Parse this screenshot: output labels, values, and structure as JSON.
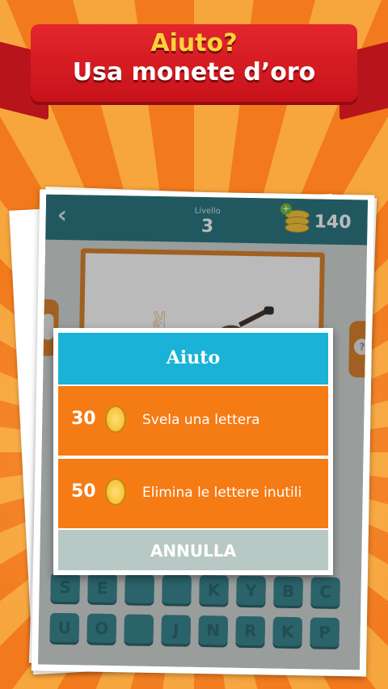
{
  "banner": {
    "line1": "Aiuto?",
    "line2": "Usa monete d’oro"
  },
  "game": {
    "level_label": "Livello",
    "level_number": "3",
    "coins": "140",
    "plus": "+",
    "back_glyph": "‹",
    "help_glyph": "?",
    "keyboard_row1": [
      "S",
      "E",
      "",
      "",
      "K",
      "Y",
      "B",
      "C"
    ],
    "keyboard_row2": [
      "U",
      "O",
      "",
      "J",
      "N",
      "R",
      "K",
      "P"
    ]
  },
  "dialog": {
    "title": "Aiuto",
    "options": [
      {
        "cost": "30",
        "label": "Svela una lettera"
      },
      {
        "cost": "50",
        "label": "Elimina le lettere inutili"
      }
    ],
    "cancel": "ANNULLA"
  },
  "colors": {
    "header_teal": "#1e6f7b",
    "dialog_header": "#1ab2d6",
    "option_orange": "#f57b14",
    "banner_red": "#e3262c"
  }
}
